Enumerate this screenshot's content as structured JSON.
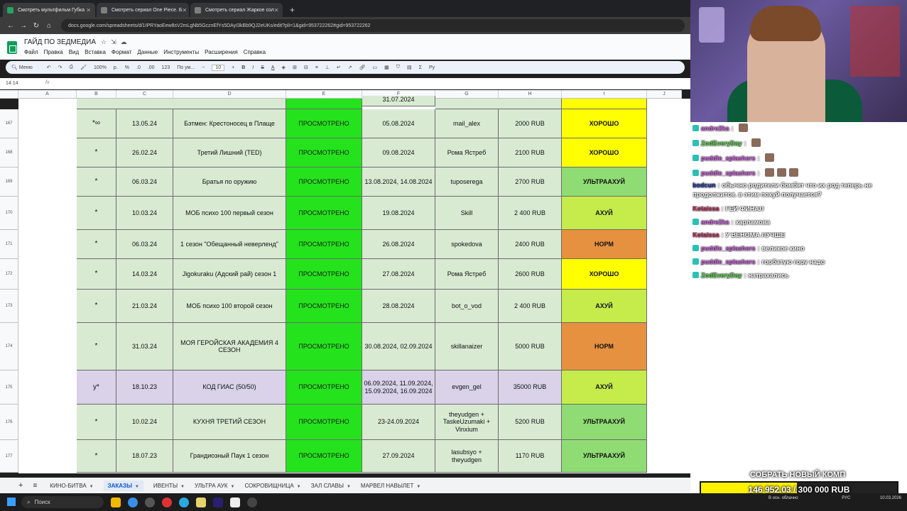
{
  "browser": {
    "tabs": [
      {
        "title": "Смотреть мультфильм Губка",
        "color": "#22a565"
      },
      {
        "title": "Смотреть сериал One Piece. Б",
        "color": "#7f7f7f"
      },
      {
        "title": "Смотреть сериал Жаркое сол",
        "color": "#7f7f7f"
      }
    ],
    "url": "docs.google.com/spreadsheets/d/1IPRYaoEew8sV2mLgNb5GcznEfYs5DAyI3kBb9QJ2eUKs/edit?pli=1&gid=953722262#gid=953722262"
  },
  "sheet": {
    "title": "ГАЙД ПО ЗЕДМЕДИА",
    "menu": [
      "Файл",
      "Правка",
      "Вид",
      "Вставка",
      "Формат",
      "Данные",
      "Инструменты",
      "Расширения",
      "Справка"
    ],
    "toolbar": {
      "menu": "Меню",
      "zoom": "100%",
      "currency": "р.",
      "percent": "%",
      "dec_minus": ".0",
      "dec_plus": ".00",
      "format123": "123",
      "font": "По ум...",
      "fontsize": "10"
    },
    "cell_ref": "14:14",
    "fx": "fx",
    "columns": [
      "A",
      "B",
      "C",
      "D",
      "E",
      "F",
      "G",
      "H",
      "I",
      "J"
    ],
    "partial_row": {
      "f": "31.07.2024"
    },
    "rows": [
      {
        "num": "167",
        "b": "*∞",
        "c": "13.05.24",
        "d": "Бэтмен: Крестоносец в Плаще",
        "e": "ПРОСМОТРЕНО",
        "f": "05.08.2024",
        "g": "mail_alex",
        "h": "2000 RUB",
        "i": "ХОРОШО",
        "bg": "green",
        "ibg": "#ffff00"
      },
      {
        "num": "168",
        "b": "*",
        "c": "26.02.24",
        "d": "Третий Лишний (TED)",
        "e": "ПРОСМОТРЕНО",
        "f": "09.08.2024",
        "g": "Рома Ястреб",
        "h": "2100 RUB",
        "i": "ХОРОШО",
        "bg": "green",
        "ibg": "#ffff00"
      },
      {
        "num": "169",
        "b": "*",
        "c": "06.03.24",
        "d": "Братья по оружию",
        "e": "ПРОСМОТРЕНО",
        "f": "13.08.2024, 14.08.2024",
        "g": "tuposerega",
        "h": "2700 RUB",
        "i": "УЛЬТРААХУЙ",
        "bg": "green",
        "ibg": "#8fdc74"
      },
      {
        "num": "170",
        "b": "*",
        "c": "10.03.24",
        "d": "МОБ психо 100 первый сезон",
        "e": "ПРОСМОТРЕНО",
        "f": "19.08.2024",
        "g": "Skill",
        "h": "2 400 RUB",
        "i": "АХУЙ",
        "bg": "green",
        "ibg": "#c5ec4a"
      },
      {
        "num": "171",
        "b": "*",
        "c": "06.03.24",
        "d": "1 сезон \"Обещанный неверленд\"",
        "e": "ПРОСМОТРЕНО",
        "f": "26.08.2024",
        "g": "spokedova",
        "h": "2400 RUB",
        "i": "НОРМ",
        "bg": "green",
        "ibg": "#e6913f"
      },
      {
        "num": "172",
        "b": "*",
        "c": "14.03.24",
        "d": "Jigokuraku (Адский рай) сезон 1",
        "e": "ПРОСМОТРЕНО",
        "f": "27.08.2024",
        "g": "Рома Ястреб",
        "h": "2600 RUB",
        "i": "ХОРОШО",
        "bg": "green",
        "ibg": "#ffff00"
      },
      {
        "num": "173",
        "b": "*",
        "c": "21.03.24",
        "d": "МОБ психо 100 второй сезон",
        "e": "ПРОСМОТРЕНО",
        "f": "28.08.2024",
        "g": "bot_o_vod",
        "h": "2 400 RUB",
        "i": "АХУЙ",
        "bg": "green",
        "ibg": "#c5ec4a"
      },
      {
        "num": "174",
        "b": "*",
        "c": "31.03.24",
        "d": "МОЯ ГЕРОЙСКАЯ АКАДЕМИЯ 4 СЕЗОН",
        "e": "ПРОСМОТРЕНО",
        "f": "30.08.2024, 02.09.2024",
        "g": "skillanaizer",
        "h": "5000 RUB",
        "i": "НОРМ",
        "bg": "green",
        "ibg": "#e6913f"
      },
      {
        "num": "175",
        "b": "y*",
        "c": "18.10.23",
        "d": "КОД ГИАС (50/50)",
        "e": "ПРОСМОТРЕНО",
        "f": "06.09.2024, 11.09.2024, 15.09.2024, 16.09.2024",
        "g": "evgen_gel",
        "h": "35000 RUB",
        "i": "АХУЙ",
        "bg": "purple",
        "ibg": "#c5ec4a"
      },
      {
        "num": "176",
        "b": "*",
        "c": "10.02.24",
        "d": "КУХНЯ ТРЕТИЙ СЕЗОН",
        "e": "ПРОСМОТРЕНО",
        "f": "23-24.09.2024",
        "g": "theyudgen + TaskeUzumaki + Vinxium",
        "h": "5200 RUB",
        "i": "УЛЬТРААХУЙ",
        "bg": "green",
        "ibg": "#8fdc74"
      },
      {
        "num": "177",
        "b": "*",
        "c": "18.07.23",
        "d": "Грандиозный Паук 1 сезон",
        "e": "ПРОСМОТРЕНО",
        "f": "27.09.2024",
        "g": "lasubsyo + theyudgen",
        "h": "1170 RUB",
        "i": "УЛЬТРААХУЙ",
        "bg": "green",
        "ibg": "#8fdc74"
      }
    ],
    "sheet_tabs": [
      {
        "label": "КИНО-БИТВА",
        "active": false
      },
      {
        "label": "ЗАКАЗЫ",
        "active": true
      },
      {
        "label": "ИВЕНТЫ",
        "active": false
      },
      {
        "label": "УЛЬТРА АУК",
        "active": false
      },
      {
        "label": "СОКРОВИЩНИЦА",
        "active": false
      },
      {
        "label": "ЗАЛ СЛАВЫ",
        "active": false
      },
      {
        "label": "МАРВЕЛ НАВЫЛЕТ",
        "active": false
      }
    ]
  },
  "chat": [
    {
      "user": "andre2ka",
      "sep": ":",
      "msg": "",
      "color": "purple",
      "emotes": 1
    },
    {
      "user": "ZodEveryDay",
      "sep": ":",
      "msg": "",
      "color": "green",
      "emotes": 1
    },
    {
      "user": "puddle_splashers",
      "sep": ":",
      "msg": "",
      "color": "purple",
      "emotes": 1
    },
    {
      "user": "puddle_splashers",
      "sep": ":",
      "msg": "",
      "color": "purple",
      "emotes": 3
    },
    {
      "user": "bodcun",
      "sep": ":",
      "msg": "обычно родители бомбят что их род теперь не продолжится. в этим похуй получается?",
      "color": "blue",
      "emotes": 0
    },
    {
      "user": "Kotaissa",
      "sep": ":",
      "msg": "ГЕЙ ФИНАЛ",
      "color": "pink",
      "emotes": 0
    },
    {
      "user": "andre2ka",
      "sep": ":",
      "msg": "харламова",
      "color": "purple",
      "emotes": 0
    },
    {
      "user": "Kotaissa",
      "sep": ":",
      "msg": "У ВЕНОМА ЛУЧШЕ",
      "color": "pink",
      "emotes": 0
    },
    {
      "user": "puddle_splashers",
      "sep": ":",
      "msg": "великое кино",
      "color": "purple",
      "emotes": 0
    },
    {
      "user": "puddle_splashers",
      "sep": ":",
      "msg": "горбатую гору надо",
      "color": "purple",
      "emotes": 0
    },
    {
      "user": "ZodEveryDay",
      "sep": ":",
      "msg": "натрахались",
      "color": "green",
      "emotes": 0
    }
  ],
  "goal": {
    "title": "СОБРАТЬ НОВЫЙ КОМП",
    "text": "146 952.03 / 300 000 RUB",
    "fraction": 0.49
  },
  "taskbar": {
    "search": "Поиск",
    "weather": "В осн. облачно",
    "lang": "РУС",
    "date": "10.03.2026"
  }
}
